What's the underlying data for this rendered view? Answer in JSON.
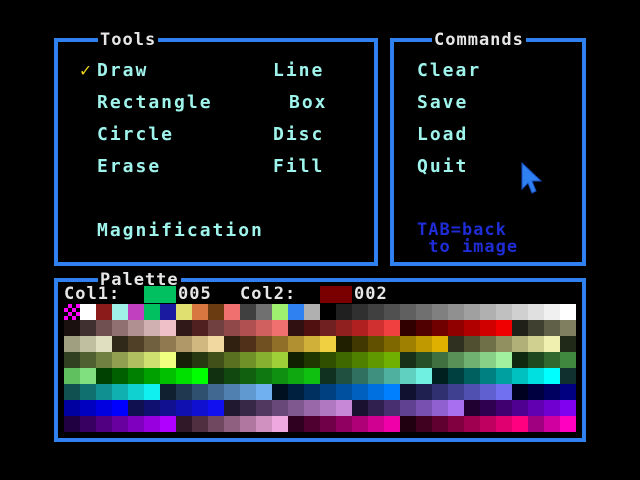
{
  "tools": {
    "title": "Tools",
    "checkmark": "✓",
    "draw": "Draw",
    "line": "Line",
    "rectangle": "Rectangle",
    "box": "Box",
    "circle": "Circle",
    "disc": "Disc",
    "erase": "Erase",
    "fill": "Fill",
    "magnification": "Magnification"
  },
  "commands": {
    "title": "Commands",
    "clear": "Clear",
    "save": "Save",
    "load": "Load",
    "quit": "Quit",
    "hint_line1": "TAB=back",
    "hint_line2": " to image"
  },
  "palette": {
    "title": "Palette",
    "col1_label": "Col1:",
    "col1_value": "005",
    "col1_color": "#00c060",
    "col2_label": "Col2:",
    "col2_value": "002",
    "col2_color": "#7a0000",
    "rows": [
      [
        "checker",
        "#ffffff",
        "#8b1a1a",
        "#a0f0e8",
        "#c040c0",
        "#00c060",
        "#1a1aa0",
        "#e0e070",
        "#d87840",
        "#6a3a10",
        "#f07070",
        "#404040",
        "#707070",
        "#a0f070",
        "#2f80f0",
        "#b0b0b0",
        "#000000",
        "#202020",
        "#303030",
        "#404040",
        "#505050",
        "#606060",
        "#707070",
        "#808080",
        "#909090",
        "#a0a0a0",
        "#b0b0b0",
        "#c0c0c0",
        "#d0d0d0",
        "#e0e0e0",
        "#f0f0f0",
        "#ffffff"
      ],
      [
        "#1a1010",
        "#403030",
        "#705050",
        "#907070",
        "#b09090",
        "#d0b0b0",
        "#f0c0c8",
        "#301818",
        "#502020",
        "#704040",
        "#904848",
        "#b05050",
        "#d06060",
        "#f07070",
        "#301010",
        "#501010",
        "#702020",
        "#902020",
        "#b02020",
        "#d03030",
        "#f04040",
        "#300000",
        "#500000",
        "#700000",
        "#900000",
        "#b00000",
        "#d00000",
        "#f00000",
        "#202018",
        "#404030",
        "#606048",
        "#808060"
      ],
      [
        "#a0a080",
        "#c0c0a0",
        "#e0e0c0",
        "#302818",
        "#504028",
        "#706040",
        "#907850",
        "#b09868",
        "#d0b880",
        "#f0d8a0",
        "#302010",
        "#503018",
        "#705020",
        "#907028",
        "#b09030",
        "#d0b038",
        "#f0d040",
        "#202000",
        "#403800",
        "#605000",
        "#806800",
        "#a08000",
        "#c09800",
        "#e0b000",
        "#303020",
        "#505030",
        "#707048",
        "#909060",
        "#b0b078",
        "#d0d090",
        "#f0f0b0",
        "#202818"
      ],
      [
        "#304020",
        "#506030",
        "#708040",
        "#90a050",
        "#b0c060",
        "#d0e070",
        "#f0ff80",
        "#182008",
        "#283810",
        "#405018",
        "#587020",
        "#709028",
        "#88b030",
        "#a0d038",
        "#102000",
        "#203800",
        "#305000",
        "#406800",
        "#508000",
        "#609800",
        "#70b000",
        "#183018",
        "#285028",
        "#407040",
        "#589058",
        "#70b070",
        "#88d088",
        "#a0f0a0",
        "#102810",
        "#204820",
        "#306830",
        "#408840"
      ],
      [
        "#60c060",
        "#80e080",
        "#004000",
        "#006000",
        "#008000",
        "#00a000",
        "#00c000",
        "#00e000",
        "#00ff00",
        "#103010",
        "#104810",
        "#106010",
        "#107810",
        "#109010",
        "#10a810",
        "#10c010",
        "#103020",
        "#205040",
        "#307060",
        "#409080",
        "#50b0a0",
        "#60d0c0",
        "#70f0e0",
        "#002020",
        "#004040",
        "#006060",
        "#008080",
        "#00a0a0",
        "#00c0c0",
        "#00e0e0",
        "#00ffff",
        "#103030"
      ],
      [
        "#105050",
        "#107070",
        "#109090",
        "#10b0b0",
        "#10d0d0",
        "#10f0f0",
        "#102030",
        "#203850",
        "#305070",
        "#406890",
        "#5080b0",
        "#6098d0",
        "#70b0f0",
        "#001020",
        "#002040",
        "#003060",
        "#004080",
        "#0050a0",
        "#0060c0",
        "#0070e0",
        "#0080ff",
        "#101030",
        "#202050",
        "#303070",
        "#404090",
        "#5050b0",
        "#6060d0",
        "#7070f0",
        "#000020",
        "#000040",
        "#000060",
        "#000080"
      ],
      [
        "#0000a0",
        "#0000c0",
        "#0000e0",
        "#0000ff",
        "#101050",
        "#101070",
        "#101090",
        "#1010b0",
        "#1010d0",
        "#1010f0",
        "#201830",
        "#382848",
        "#503860",
        "#684878",
        "#805890",
        "#9868a8",
        "#b078c0",
        "#c888d8",
        "#1a1030",
        "#302050",
        "#483070",
        "#604090",
        "#7850b0",
        "#9060d0",
        "#a870f0",
        "#200030",
        "#300050",
        "#400070",
        "#500090",
        "#6000b0",
        "#7000d0",
        "#8000f0"
      ],
      [
        "#200040",
        "#380060",
        "#500080",
        "#6800a0",
        "#8000c0",
        "#9800e0",
        "#b000ff",
        "#301828",
        "#503040",
        "#704860",
        "#906080",
        "#b078a0",
        "#d090c0",
        "#f0a8e0",
        "#300020",
        "#500030",
        "#700048",
        "#900060",
        "#b00078",
        "#d00090",
        "#f000a8",
        "#200010",
        "#400020",
        "#600030",
        "#800040",
        "#a00050",
        "#c00060",
        "#e00070",
        "#ff0080",
        "#a00080",
        "#d000a0",
        "#ff00c0"
      ]
    ]
  },
  "colors": {
    "border": "#2f80f0",
    "menu_text": "#9ff4ec",
    "title_text": "#e6e6e6",
    "check": "#f2d21a",
    "hint_text": "#1e2dd6",
    "pointer": "#2f80f0"
  },
  "icons": {
    "pointer": "arrow-pointer-icon",
    "check": "checkmark-icon"
  }
}
